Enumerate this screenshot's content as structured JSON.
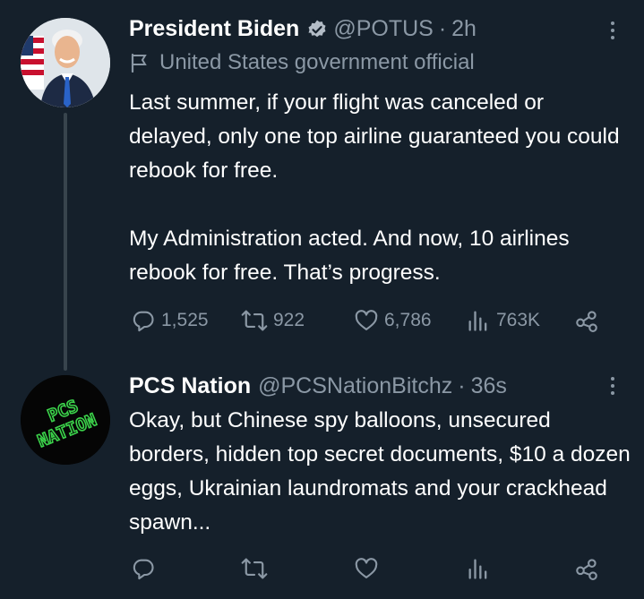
{
  "tweets": [
    {
      "display_name": "President Biden",
      "handle": "@POTUS",
      "separator": "·",
      "time": "2h",
      "label": "United States government official",
      "text": "Last summer, if your flight was canceled or delayed, only one top airline guaranteed you could rebook for free.\n\nMy Administration acted. And now, 10 airlines rebook for free. That’s progress.",
      "stats": {
        "replies": "1,525",
        "retweets": "922",
        "likes": "6,786",
        "views": "763K"
      }
    },
    {
      "display_name": "PCS Nation",
      "handle": "@PCSNationBitchz",
      "separator": "·",
      "time": "36s",
      "avatar_text": "PCS NATION",
      "text": "Okay, but Chinese spy balloons, unsecured borders, hidden top secret documents, $10 a dozen eggs, Ukrainian laundromats and your crackhead spawn...",
      "stats": {
        "replies": "",
        "retweets": "",
        "likes": "",
        "views": ""
      }
    }
  ],
  "icons": {
    "verified": "verified-badge-icon",
    "label": "flag-icon",
    "more": "more-dots-icon",
    "reply": "reply-icon",
    "retweet": "retweet-icon",
    "like": "heart-icon",
    "views": "views-icon",
    "share": "share-icon"
  },
  "colors": {
    "background": "#15202b",
    "text": "#ffffff",
    "secondary": "#8b98a5",
    "thread_line": "#38444d",
    "pcs_green": "#3bd14a"
  }
}
